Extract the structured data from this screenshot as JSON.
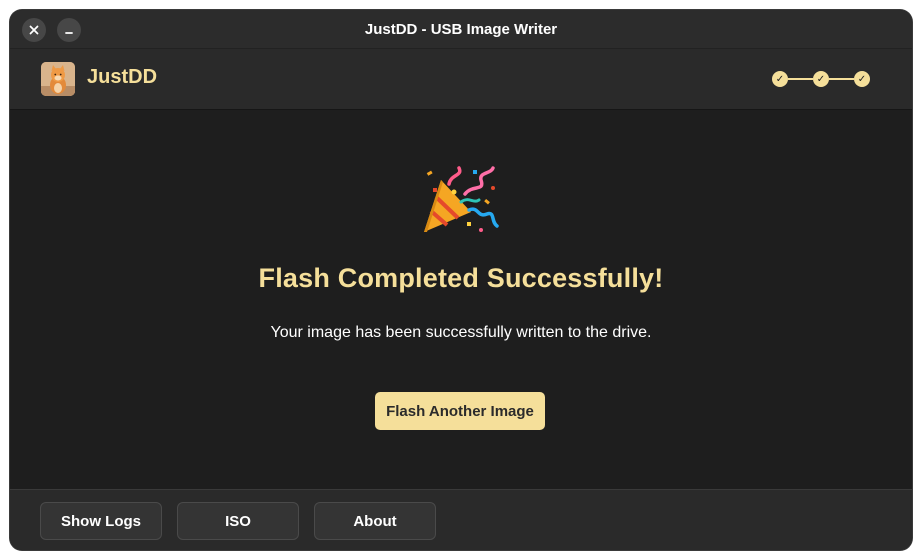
{
  "window": {
    "title": "JustDD - USB Image Writer",
    "close_icon": "close-icon",
    "minimize_icon": "minimize-icon"
  },
  "header": {
    "app_name": "JustDD",
    "logo_icon": "cat-avatar-logo",
    "steps": [
      {
        "state": "complete",
        "glyph": "✓"
      },
      {
        "state": "complete",
        "glyph": "✓"
      },
      {
        "state": "complete",
        "glyph": "✓"
      }
    ]
  },
  "main": {
    "icon": "party-popper-icon",
    "headline": "Flash Completed Successfully!",
    "message": "Your image has been successfully written to the drive.",
    "primary_button": "Flash Another Image"
  },
  "footer": {
    "buttons": [
      {
        "label": "Show Logs"
      },
      {
        "label": "ISO"
      },
      {
        "label": "About"
      }
    ]
  },
  "colors": {
    "accent": "#f5df9a",
    "background": "#1e1e1e",
    "header_bg": "#2a2a2a",
    "titlebar_bg": "#2c2c2c",
    "button_bg": "#343434"
  }
}
